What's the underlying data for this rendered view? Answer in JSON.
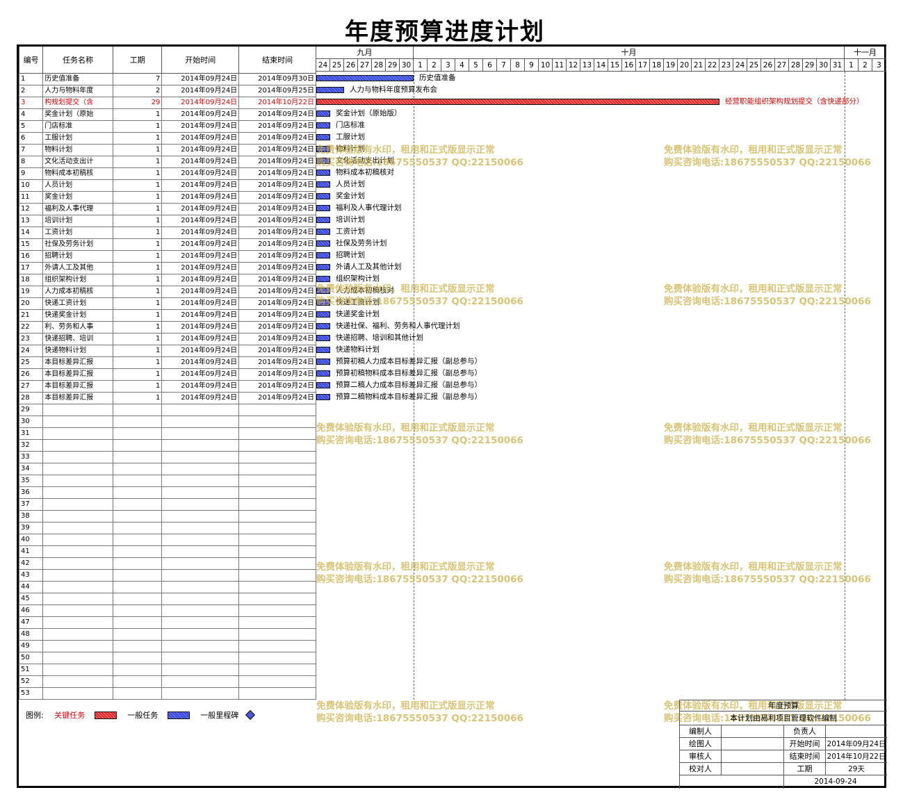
{
  "title": "年度预算进度计划",
  "table": {
    "headers": {
      "id": "编号",
      "name": "任务名称",
      "duration": "工期",
      "start": "开始时间",
      "end": "结束时间"
    },
    "tasks": [
      {
        "id": "1",
        "name": "历史值准备",
        "duration": "7",
        "start": "2014年09月24日",
        "end": "2014年09月30日",
        "critical": false,
        "day_start": 0,
        "days": 7,
        "label": "历史值准备"
      },
      {
        "id": "2",
        "name": "人力与物料年度",
        "duration": "2",
        "start": "2014年09月24日",
        "end": "2014年09月25日",
        "critical": false,
        "day_start": 0,
        "days": 2,
        "label": "人力与物料年度预算发布会"
      },
      {
        "id": "3",
        "name": "构规划提交（含",
        "duration": "29",
        "start": "2014年09月24日",
        "end": "2014年10月22日",
        "critical": true,
        "day_start": 0,
        "days": 29,
        "label": "经营职能组织架构规划提交（含快递部分）"
      },
      {
        "id": "4",
        "name": "奖金计划（原始",
        "duration": "1",
        "start": "2014年09月24日",
        "end": "2014年09月24日",
        "critical": false,
        "day_start": 0,
        "days": 1,
        "label": "奖金计划（原始版）"
      },
      {
        "id": "5",
        "name": "门店标准",
        "duration": "1",
        "start": "2014年09月24日",
        "end": "2014年09月24日",
        "critical": false,
        "day_start": 0,
        "days": 1,
        "label": "门店标准"
      },
      {
        "id": "6",
        "name": "工服计划",
        "duration": "1",
        "start": "2014年09月24日",
        "end": "2014年09月24日",
        "critical": false,
        "day_start": 0,
        "days": 1,
        "label": "工服计划"
      },
      {
        "id": "7",
        "name": "物料计划",
        "duration": "1",
        "start": "2014年09月24日",
        "end": "2014年09月24日",
        "critical": false,
        "day_start": 0,
        "days": 1,
        "label": "物料计划"
      },
      {
        "id": "8",
        "name": "文化活动支出计",
        "duration": "1",
        "start": "2014年09月24日",
        "end": "2014年09月24日",
        "critical": false,
        "day_start": 0,
        "days": 1,
        "label": "文化活动支出计划"
      },
      {
        "id": "9",
        "name": "物料成本初稿核",
        "duration": "1",
        "start": "2014年09月24日",
        "end": "2014年09月24日",
        "critical": false,
        "day_start": 0,
        "days": 1,
        "label": "物料成本初稿核对"
      },
      {
        "id": "10",
        "name": "人员计划",
        "duration": "1",
        "start": "2014年09月24日",
        "end": "2014年09月24日",
        "critical": false,
        "day_start": 0,
        "days": 1,
        "label": "人员计划"
      },
      {
        "id": "11",
        "name": "奖金计划",
        "duration": "1",
        "start": "2014年09月24日",
        "end": "2014年09月24日",
        "critical": false,
        "day_start": 0,
        "days": 1,
        "label": "奖金计划"
      },
      {
        "id": "12",
        "name": "福利及人事代理",
        "duration": "1",
        "start": "2014年09月24日",
        "end": "2014年09月24日",
        "critical": false,
        "day_start": 0,
        "days": 1,
        "label": "福利及人事代理计划"
      },
      {
        "id": "13",
        "name": "培训计划",
        "duration": "1",
        "start": "2014年09月24日",
        "end": "2014年09月24日",
        "critical": false,
        "day_start": 0,
        "days": 1,
        "label": "培训计划"
      },
      {
        "id": "14",
        "name": "工资计划",
        "duration": "1",
        "start": "2014年09月24日",
        "end": "2014年09月24日",
        "critical": false,
        "day_start": 0,
        "days": 1,
        "label": "工资计划"
      },
      {
        "id": "15",
        "name": "社保及劳务计划",
        "duration": "1",
        "start": "2014年09月24日",
        "end": "2014年09月24日",
        "critical": false,
        "day_start": 0,
        "days": 1,
        "label": "社保及劳务计划"
      },
      {
        "id": "16",
        "name": "招聘计划",
        "duration": "1",
        "start": "2014年09月24日",
        "end": "2014年09月24日",
        "critical": false,
        "day_start": 0,
        "days": 1,
        "label": "招聘计划"
      },
      {
        "id": "17",
        "name": "外请人工及其他",
        "duration": "1",
        "start": "2014年09月24日",
        "end": "2014年09月24日",
        "critical": false,
        "day_start": 0,
        "days": 1,
        "label": "外请人工及其他计划"
      },
      {
        "id": "18",
        "name": "组织架构计划",
        "duration": "1",
        "start": "2014年09月24日",
        "end": "2014年09月24日",
        "critical": false,
        "day_start": 0,
        "days": 1,
        "label": "组织架构计划"
      },
      {
        "id": "19",
        "name": "人力成本初稿核",
        "duration": "1",
        "start": "2014年09月24日",
        "end": "2014年09月24日",
        "critical": false,
        "day_start": 0,
        "days": 1,
        "label": "人力成本初稿核对"
      },
      {
        "id": "20",
        "name": "快递工资计划",
        "duration": "1",
        "start": "2014年09月24日",
        "end": "2014年09月24日",
        "critical": false,
        "day_start": 0,
        "days": 1,
        "label": "快递工资计划"
      },
      {
        "id": "21",
        "name": "快递奖金计划",
        "duration": "1",
        "start": "2014年09月24日",
        "end": "2014年09月24日",
        "critical": false,
        "day_start": 0,
        "days": 1,
        "label": "快递奖金计划"
      },
      {
        "id": "22",
        "name": "利、劳务和人事",
        "duration": "1",
        "start": "2014年09月24日",
        "end": "2014年09月24日",
        "critical": false,
        "day_start": 0,
        "days": 1,
        "label": "快递社保、福利、劳务和人事代理计划"
      },
      {
        "id": "23",
        "name": "快递招聘、培训",
        "duration": "1",
        "start": "2014年09月24日",
        "end": "2014年09月24日",
        "critical": false,
        "day_start": 0,
        "days": 1,
        "label": "快递招聘、培训和其他计划"
      },
      {
        "id": "24",
        "name": "快递物料计划",
        "duration": "1",
        "start": "2014年09月24日",
        "end": "2014年09月24日",
        "critical": false,
        "day_start": 0,
        "days": 1,
        "label": "快递物料计划"
      },
      {
        "id": "25",
        "name": "本目标差异汇报",
        "duration": "1",
        "start": "2014年09月24日",
        "end": "2014年09月24日",
        "critical": false,
        "day_start": 0,
        "days": 1,
        "label": "预算初稿人力成本目标差异汇报（副总参与）"
      },
      {
        "id": "26",
        "name": "本目标差异汇报",
        "duration": "1",
        "start": "2014年09月24日",
        "end": "2014年09月24日",
        "critical": false,
        "day_start": 0,
        "days": 1,
        "label": "预算初稿物料成本目标差异汇报（副总参与）"
      },
      {
        "id": "27",
        "name": "本目标差异汇报",
        "duration": "1",
        "start": "2014年09月24日",
        "end": "2014年09月24日",
        "critical": false,
        "day_start": 0,
        "days": 1,
        "label": "预算二稿人力成本目标差异汇报（副总参与）"
      },
      {
        "id": "28",
        "name": "本目标差异汇报",
        "duration": "1",
        "start": "2014年09月24日",
        "end": "2014年09月24日",
        "critical": false,
        "day_start": 0,
        "days": 1,
        "label": "预算二稿物料成本目标差异汇报（副总参与）"
      }
    ],
    "empty_ids": [
      "29",
      "30",
      "31",
      "32",
      "33",
      "34",
      "35",
      "36",
      "37",
      "38",
      "39",
      "40",
      "41",
      "42",
      "43",
      "44",
      "45",
      "46",
      "47",
      "48",
      "49",
      "50",
      "51",
      "52",
      "53"
    ]
  },
  "timeline": {
    "months": [
      {
        "label": "九月",
        "days": [
          "24",
          "25",
          "26",
          "27",
          "28",
          "29",
          "30"
        ]
      },
      {
        "label": "十月",
        "days": [
          "1",
          "2",
          "3",
          "4",
          "5",
          "6",
          "7",
          "8",
          "9",
          "10",
          "11",
          "12",
          "13",
          "14",
          "15",
          "16",
          "17",
          "18",
          "19",
          "20",
          "21",
          "22",
          "23",
          "24",
          "25",
          "26",
          "27",
          "28",
          "29",
          "30",
          "31"
        ]
      },
      {
        "label": "十一月",
        "days": [
          "1",
          "2",
          "3"
        ]
      }
    ]
  },
  "watermark": {
    "line1": "免费体验版有水印，租用和正式版显示正常",
    "line2": "购买咨询电话:18675550537 QQ:22150066",
    "color": "#cdaf46"
  },
  "legend": {
    "prefix": "图例:",
    "critical": "关键任务",
    "normal": "一般任务",
    "milestone": "一般里程碑",
    "critical_color": "#e02828",
    "normal_color": "#3848d8"
  },
  "title_block": {
    "name": "年度预算",
    "note": "本计划由易利项目管理软件编制",
    "rows": [
      {
        "k1": "编制人",
        "v1": "",
        "k2": "负责人",
        "v2": ""
      },
      {
        "k1": "绘图人",
        "v1": "",
        "k2": "开始时间",
        "v2": "2014年09月24日"
      },
      {
        "k1": "审核人",
        "v1": "",
        "k2": "结束时间",
        "v2": "2014年10月22日"
      },
      {
        "k1": "校对人",
        "v1": "",
        "k2": "工期",
        "v2": "29天"
      }
    ],
    "date": "2014-09-24"
  }
}
